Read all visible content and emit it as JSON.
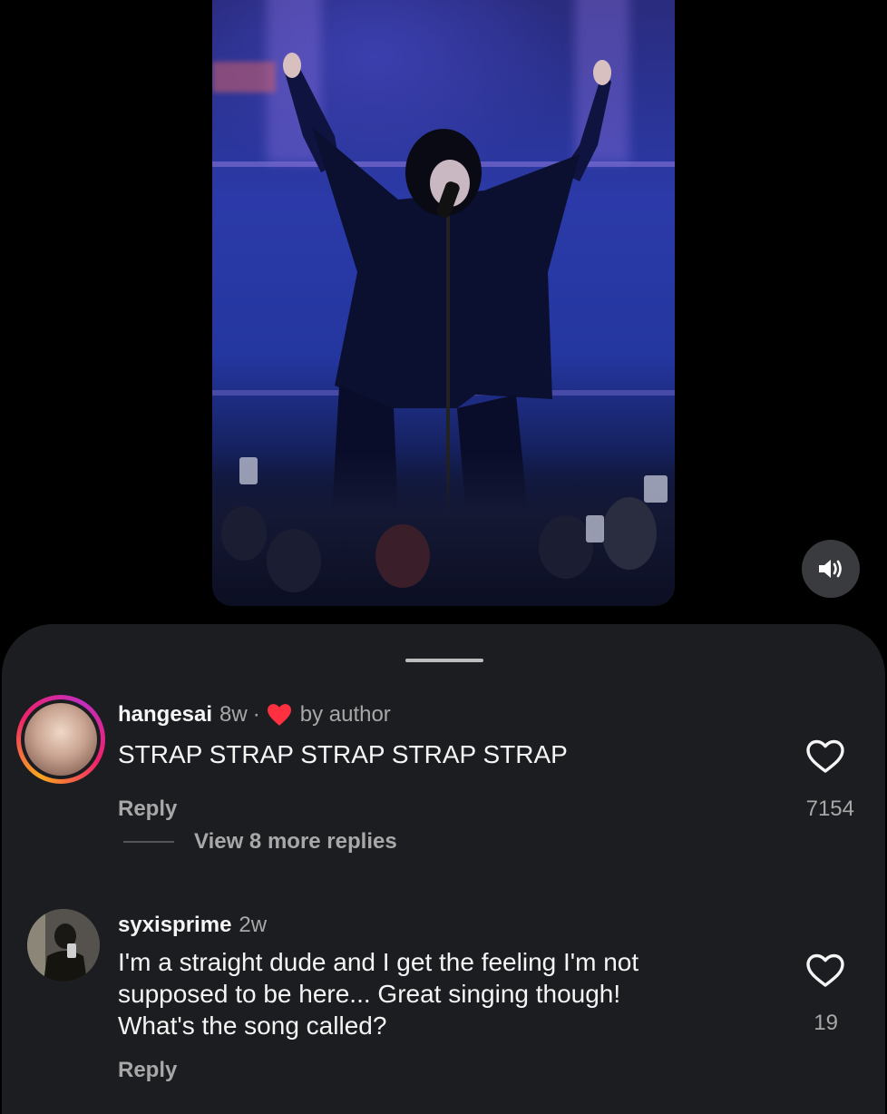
{
  "video": {
    "mute_icon": "speaker-on-icon"
  },
  "comments": [
    {
      "username": "hangesai",
      "time": "8w",
      "separator": "·",
      "liked_by_author_icon": "heart-filled-icon",
      "liked_by_author_color": "#ff3040",
      "by_author": "by author",
      "text": "STRAP STRAP STRAP STRAP STRAP",
      "reply_label": "Reply",
      "likes": "7154",
      "view_more": "View 8 more replies"
    },
    {
      "username": "syxisprime",
      "time": "2w",
      "text_lines": [
        "I'm a straight dude and I get the feeling I'm not",
        "supposed to be here... Great singing though!",
        "What's the song called?"
      ],
      "reply_label": "Reply",
      "likes": "19"
    }
  ]
}
